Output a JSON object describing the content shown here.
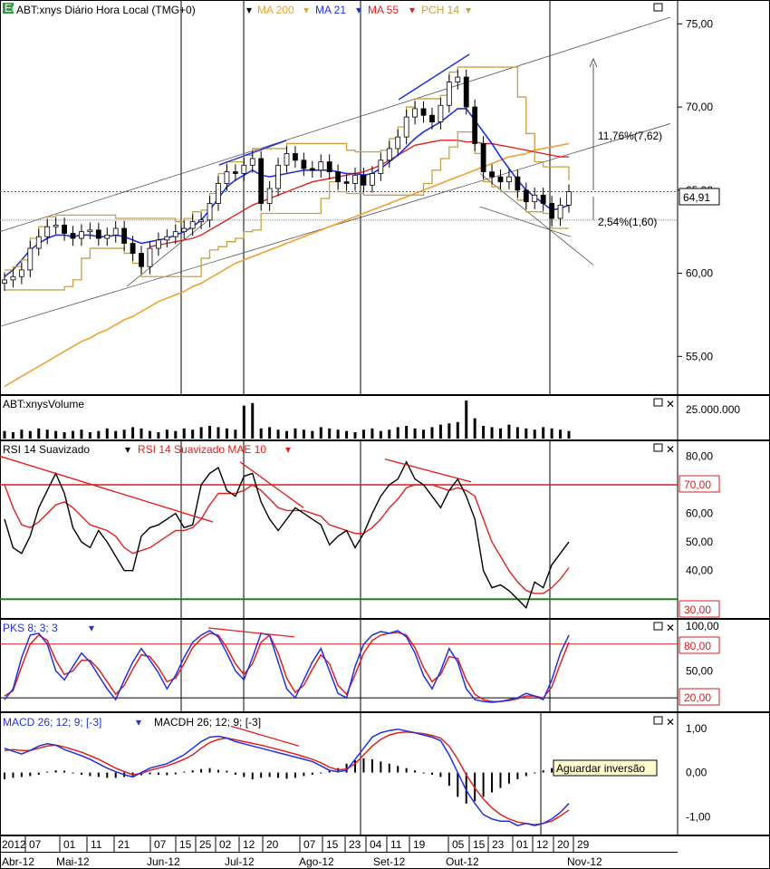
{
  "panels": {
    "price": {
      "symbol": "ABT:xnys Diário Hora Local (TMG+0)",
      "indicators": [
        {
          "label": "MA 200",
          "color": "#f0a030"
        },
        {
          "label": "MA 21",
          "color": "#2030e0"
        },
        {
          "label": "MA 55",
          "color": "#e02020"
        },
        {
          "label": "PCH 14",
          "color": "#c8a040"
        }
      ],
      "last_price": "64,91",
      "annotation_up": "11,76%(7,62)",
      "annotation_down": "2,54%(1,60)"
    },
    "volume": {
      "label": "ABT:xnysVolume",
      "axis_label": "25.000.000"
    },
    "rsi": {
      "label": "RSI 14 Suavizado",
      "label2": "RSI 14 Suavizado MAE 10",
      "level_high": "70,00",
      "level_low": "30,00"
    },
    "pks": {
      "label": "PKS 8; 3; 3",
      "level_high": "80,00",
      "level_low": "20,00"
    },
    "macd": {
      "label": "MACD 26; 12; 9; [-3]",
      "label2": "MACDH 26; 12; 9; [-3]",
      "annotation": "Aguardar inversão"
    }
  },
  "colors": {
    "ma200": "#f0a030",
    "ma21": "#2030e0",
    "ma55": "#e02020",
    "pch": "#c8a040",
    "rsi": "#000000",
    "rsi_ma": "#e02020",
    "pks_k": "#2030e0",
    "pks_d": "#e02020",
    "level70": "#d02020",
    "level30": "#208020"
  },
  "chart_data": [
    {
      "type": "line",
      "panel": "price",
      "ylim": [
        53,
        76
      ],
      "y_ticks": [
        "75,00",
        "70,00",
        "65,00",
        "60,00",
        "55,00"
      ],
      "x_ticks": [
        "2012",
        "07",
        "01",
        "11",
        "21",
        "07",
        "15",
        "25",
        "02",
        "12",
        "20",
        "07",
        "15",
        "23",
        "04",
        "11",
        "19",
        "05",
        "15",
        "23",
        "01",
        "12",
        "20",
        "29"
      ],
      "months": [
        "Abr-12",
        "Mai-12",
        "Jun-12",
        "Jul-12",
        "Ago-12",
        "Set-12",
        "Out-12",
        "Nov-12"
      ],
      "close": [
        59.6,
        59.8,
        60.2,
        61.5,
        62.2,
        62.8,
        62.9,
        62.4,
        62.1,
        62.5,
        62.6,
        62.1,
        62.3,
        62.7,
        61.8,
        61.2,
        60.4,
        61.5,
        62.0,
        62.2,
        62.5,
        62.7,
        63.1,
        63.2,
        64.2,
        65.4,
        66.1,
        66.0,
        66.5,
        66.9,
        64.2,
        65.1,
        66.5,
        67.2,
        66.8,
        66.3,
        66.2,
        66.7,
        66.1,
        65.5,
        65.4,
        65.9,
        65.3,
        66.0,
        66.8,
        67.5,
        68.2,
        69.4,
        69.9,
        69.5,
        69.1,
        70.1,
        71.5,
        71.8,
        70.0,
        67.8,
        66.1,
        65.8,
        65.5,
        65.8,
        65.0,
        64.3,
        64.7,
        64.2,
        63.3,
        64.1,
        64.9
      ],
      "ma21": [
        59.8,
        60.2,
        60.8,
        61.4,
        61.8,
        62.1,
        62.3,
        62.3,
        62.2,
        62.3,
        62.3,
        62.2,
        62.2,
        62.3,
        62.2,
        62.0,
        61.8,
        61.9,
        62.0,
        62.1,
        62.3,
        62.5,
        62.8,
        63.2,
        63.8,
        64.5,
        65.2,
        65.6,
        65.9,
        66.2,
        65.9,
        65.8,
        65.9,
        66.0,
        66.1,
        66.2,
        66.2,
        66.2,
        66.2,
        66.1,
        66.0,
        66.0,
        65.9,
        66.0,
        66.3,
        66.7,
        67.1,
        67.6,
        68.1,
        68.5,
        68.8,
        69.1,
        69.5,
        69.9,
        69.9,
        69.2,
        68.5,
        67.8,
        67.0,
        66.3,
        65.6,
        65.0,
        64.6,
        64.2,
        63.8,
        63.9,
        64.1
      ],
      "ma55": [
        null,
        null,
        null,
        null,
        null,
        null,
        null,
        null,
        null,
        null,
        null,
        null,
        null,
        null,
        null,
        null,
        null,
        61.6,
        61.7,
        61.8,
        61.9,
        62.0,
        62.1,
        62.3,
        62.6,
        62.9,
        63.2,
        63.5,
        63.8,
        64.1,
        64.3,
        64.5,
        64.7,
        64.9,
        65.1,
        65.3,
        65.5,
        65.6,
        65.7,
        65.8,
        65.9,
        66.0,
        66.1,
        66.3,
        66.5,
        66.8,
        67.1,
        67.4,
        67.7,
        67.8,
        67.9,
        68.0,
        68.0,
        68.0,
        67.9,
        67.9,
        67.8,
        67.8,
        67.7,
        67.6,
        67.5,
        67.4,
        67.3,
        67.2,
        67.1,
        67.0,
        67.0
      ],
      "ma200": [
        53.2,
        53.5,
        53.8,
        54.1,
        54.4,
        54.7,
        55.0,
        55.3,
        55.6,
        55.9,
        56.1,
        56.4,
        56.6,
        56.9,
        57.2,
        57.4,
        57.7,
        58.0,
        58.3,
        58.5,
        58.7,
        58.9,
        59.2,
        59.4,
        59.7,
        60.0,
        60.3,
        60.6,
        60.8,
        61.0,
        61.2,
        61.4,
        61.6,
        61.8,
        62.0,
        62.2,
        62.4,
        62.6,
        62.8,
        63.0,
        63.2,
        63.4,
        63.6,
        63.8,
        64.0,
        64.2,
        64.4,
        64.6,
        64.8,
        65.0,
        65.2,
        65.4,
        65.6,
        65.8,
        66.0,
        66.2,
        66.4,
        66.6,
        66.8,
        67.0,
        67.1,
        67.2,
        67.4,
        67.5,
        67.6,
        67.7,
        67.8
      ]
    },
    {
      "type": "bar",
      "panel": "volume",
      "ylim": [
        0,
        30000000
      ],
      "values": [
        6,
        5,
        7,
        6,
        8,
        7,
        6,
        5,
        6,
        7,
        5,
        6,
        8,
        6,
        7,
        9,
        8,
        6,
        5,
        7,
        6,
        8,
        7,
        9,
        10,
        9,
        8,
        7,
        26,
        28,
        8,
        9,
        7,
        6,
        8,
        7,
        6,
        9,
        8,
        7,
        6,
        5,
        7,
        8,
        6,
        7,
        9,
        10,
        8,
        7,
        9,
        11,
        12,
        13,
        30,
        16,
        10,
        9,
        8,
        11,
        9,
        8,
        7,
        9,
        8,
        7,
        6
      ]
    },
    {
      "type": "line",
      "panel": "rsi",
      "ylim": [
        25,
        83
      ],
      "y_ticks": [
        "80,00",
        "70,00",
        "60,00",
        "50,00",
        "40,00",
        "30,00"
      ],
      "rsi": [
        58,
        48,
        46,
        52,
        62,
        68,
        74,
        67,
        55,
        50,
        48,
        54,
        50,
        45,
        40,
        40,
        52,
        55,
        56,
        58,
        60,
        55,
        56,
        70,
        74,
        76,
        68,
        66,
        73,
        74,
        64,
        58,
        54,
        58,
        62,
        60,
        58,
        56,
        49,
        52,
        54,
        48,
        53,
        60,
        66,
        70,
        72,
        78,
        72,
        70,
        66,
        62,
        68,
        72,
        66,
        58,
        40,
        34,
        35,
        33,
        30,
        27,
        36,
        34,
        42,
        46,
        50
      ],
      "rsi_ma": [
        70,
        62,
        56,
        55,
        57,
        60,
        63,
        64,
        62,
        59,
        56,
        55,
        54,
        52,
        48,
        46,
        47,
        48,
        50,
        52,
        54,
        54,
        55,
        58,
        63,
        67,
        67,
        67,
        68,
        70,
        68,
        65,
        62,
        61,
        61,
        61,
        60,
        59,
        56,
        55,
        54,
        53,
        53,
        55,
        58,
        62,
        65,
        69,
        70,
        70,
        70,
        69,
        68,
        69,
        68,
        66,
        58,
        50,
        45,
        40,
        36,
        33,
        32,
        32,
        34,
        37,
        41
      ]
    },
    {
      "type": "line",
      "panel": "pks",
      "ylim": [
        10,
        100
      ],
      "y_ticks": [
        "100,00",
        "80,00",
        "50,00",
        "20,00"
      ],
      "k": [
        18,
        30,
        65,
        90,
        92,
        80,
        50,
        40,
        55,
        70,
        60,
        45,
        30,
        18,
        40,
        60,
        75,
        62,
        48,
        30,
        45,
        65,
        82,
        90,
        95,
        88,
        70,
        50,
        40,
        65,
        92,
        90,
        60,
        30,
        20,
        40,
        60,
        75,
        50,
        25,
        20,
        55,
        80,
        90,
        94,
        92,
        95,
        88,
        70,
        45,
        30,
        50,
        75,
        60,
        30,
        18,
        16,
        15,
        16,
        18,
        20,
        25,
        22,
        18,
        40,
        70,
        90
      ],
      "d": [
        22,
        28,
        55,
        80,
        90,
        84,
        62,
        46,
        50,
        62,
        62,
        52,
        38,
        24,
        34,
        52,
        68,
        66,
        54,
        38,
        42,
        58,
        76,
        86,
        92,
        90,
        76,
        58,
        46,
        58,
        82,
        90,
        70,
        42,
        26,
        34,
        52,
        68,
        58,
        34,
        24,
        46,
        70,
        84,
        90,
        92,
        93,
        90,
        76,
        54,
        38,
        46,
        66,
        64,
        40,
        24,
        18,
        16,
        16,
        17,
        19,
        22,
        22,
        20,
        32,
        58,
        82
      ]
    },
    {
      "type": "line",
      "panel": "macd",
      "ylim": [
        -1.3,
        1.2
      ],
      "y_ticks": [
        "1,00",
        "0,00",
        "-1,00"
      ],
      "macd": [
        0.55,
        0.48,
        0.42,
        0.5,
        0.6,
        0.65,
        0.62,
        0.52,
        0.45,
        0.38,
        0.3,
        0.2,
        0.1,
        0.02,
        -0.05,
        -0.1,
        0.0,
        0.1,
        0.15,
        0.2,
        0.3,
        0.4,
        0.55,
        0.7,
        0.8,
        0.82,
        0.78,
        0.7,
        0.65,
        0.6,
        0.55,
        0.5,
        0.45,
        0.4,
        0.35,
        0.3,
        0.25,
        0.15,
        0.05,
        0.02,
        0.05,
        0.3,
        0.55,
        0.8,
        0.9,
        0.95,
        0.98,
        0.94,
        0.9,
        0.85,
        0.8,
        0.72,
        0.4,
        0.0,
        -0.4,
        -0.7,
        -0.95,
        -1.05,
        -1.1,
        -1.1,
        -1.2,
        -1.15,
        -1.2,
        -1.15,
        -1.05,
        -0.9,
        -0.7
      ],
      "signal": [
        0.5,
        0.52,
        0.5,
        0.5,
        0.55,
        0.6,
        0.62,
        0.58,
        0.52,
        0.46,
        0.38,
        0.3,
        0.2,
        0.1,
        0.02,
        -0.05,
        -0.02,
        0.05,
        0.1,
        0.15,
        0.22,
        0.3,
        0.4,
        0.55,
        0.68,
        0.75,
        0.78,
        0.74,
        0.7,
        0.66,
        0.62,
        0.57,
        0.52,
        0.47,
        0.42,
        0.36,
        0.3,
        0.22,
        0.12,
        0.06,
        0.08,
        0.2,
        0.4,
        0.6,
        0.75,
        0.85,
        0.9,
        0.92,
        0.9,
        0.88,
        0.84,
        0.78,
        0.6,
        0.3,
        -0.05,
        -0.35,
        -0.6,
        -0.8,
        -0.95,
        -1.05,
        -1.12,
        -1.15,
        -1.18,
        -1.15,
        -1.1,
        -0.98,
        -0.85
      ],
      "hist": [
        -0.15,
        -0.12,
        -0.1,
        -0.08,
        -0.05,
        0.02,
        0.05,
        0.04,
        0.0,
        -0.05,
        -0.08,
        -0.1,
        -0.12,
        -0.12,
        -0.1,
        -0.08,
        -0.06,
        -0.04,
        -0.05,
        -0.06,
        -0.04,
        0.02,
        0.05,
        0.08,
        0.1,
        0.06,
        0.04,
        -0.05,
        -0.1,
        -0.15,
        -0.12,
        -0.1,
        -0.12,
        -0.14,
        -0.12,
        -0.08,
        -0.05,
        -0.02,
        0.06,
        0.1,
        0.2,
        0.28,
        0.32,
        0.3,
        0.25,
        0.2,
        0.15,
        0.1,
        0.05,
        0.0,
        -0.05,
        -0.1,
        -0.3,
        -0.55,
        -0.7,
        -0.65,
        -0.55,
        -0.45,
        -0.35,
        -0.25,
        -0.15,
        -0.08,
        0.0,
        0.05,
        0.1,
        0.15,
        0.2
      ]
    }
  ]
}
